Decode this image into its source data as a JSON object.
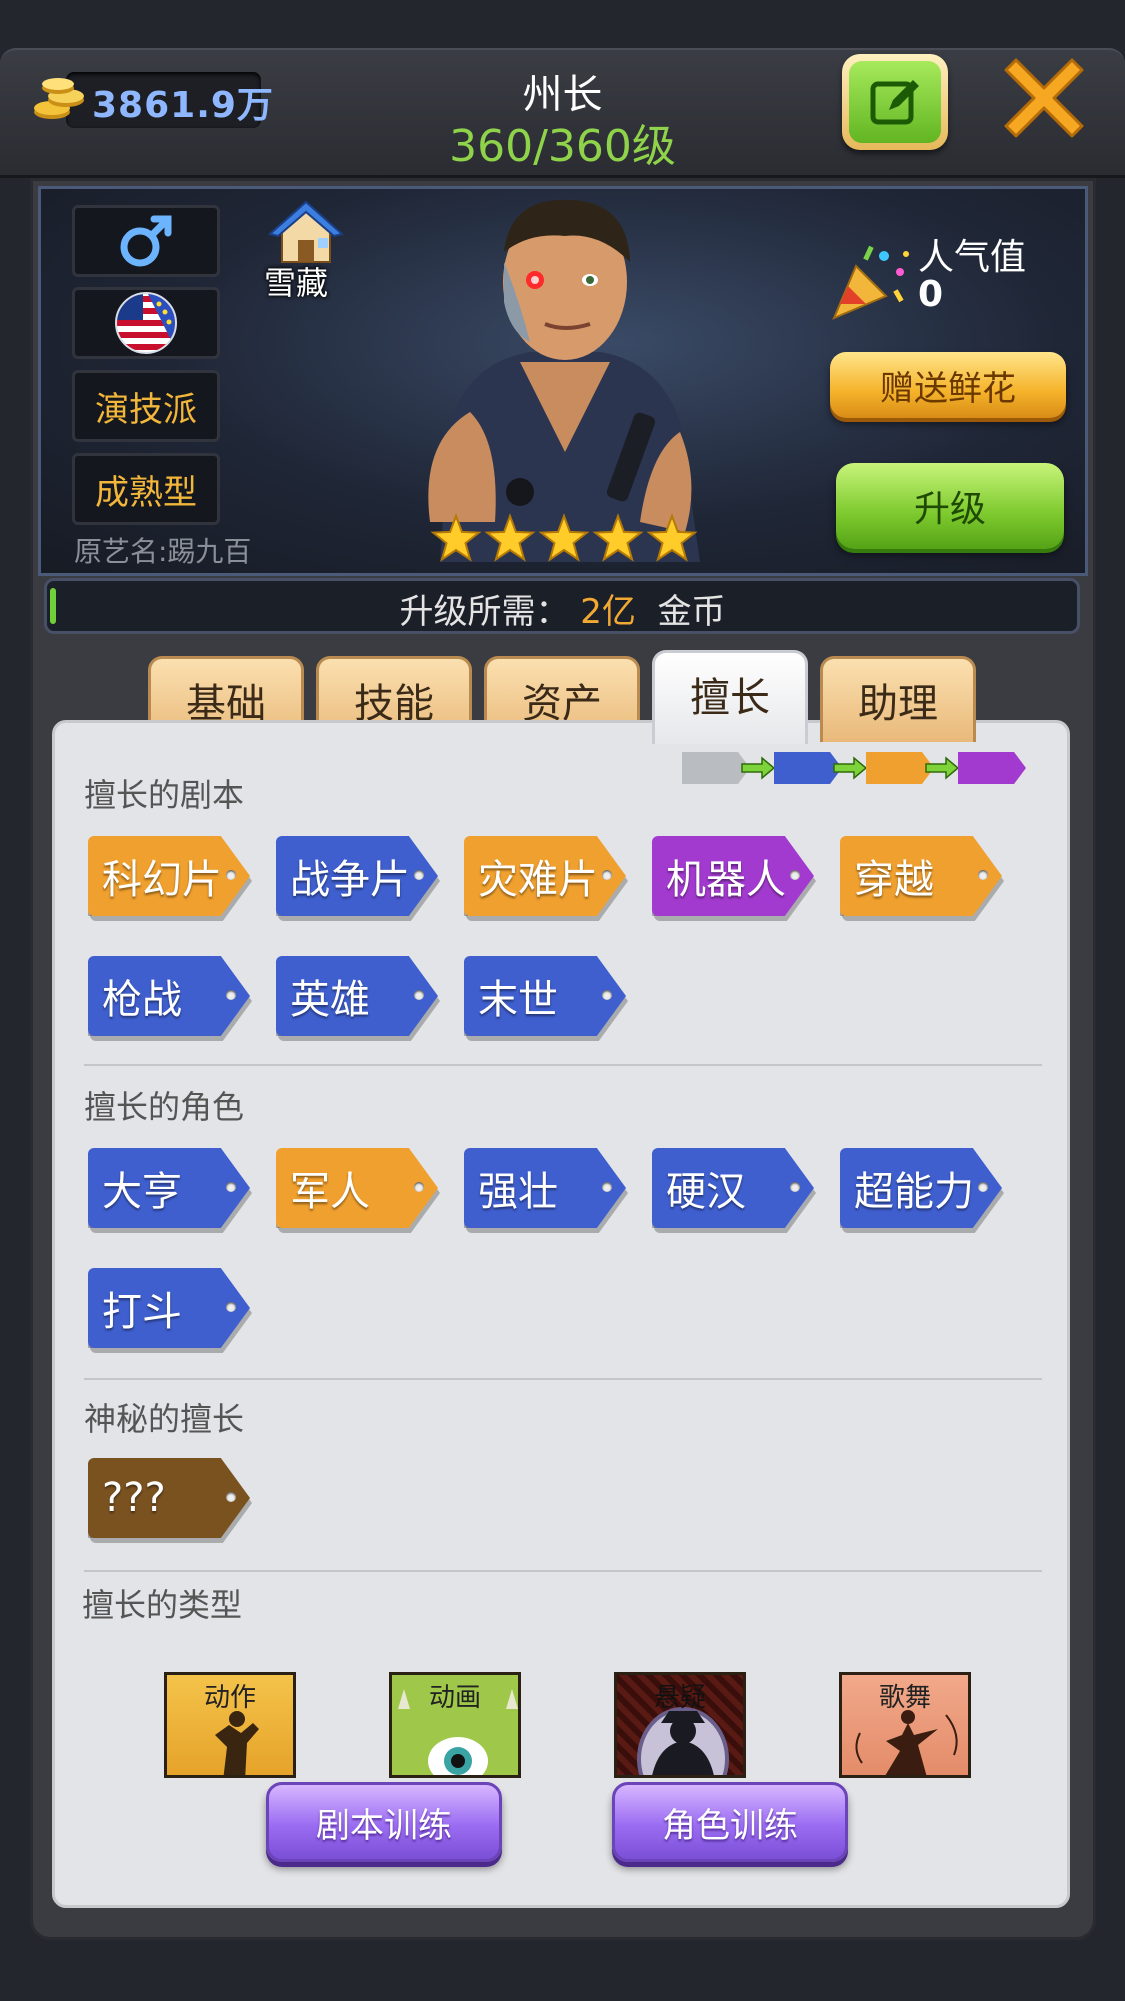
{
  "header": {
    "coins": "3861.9万",
    "rank_title": "州长",
    "level": "360/360级"
  },
  "profile": {
    "gender_icon": "male-symbol-icon",
    "nationality_icon": "us-eu-flag-icon",
    "acting_style": "演技派",
    "look_type": "成熟型",
    "former_name": "原艺名:踢九百",
    "house_label": "雪藏",
    "star_count": 5,
    "popularity_label": "人气值",
    "popularity_value": "0",
    "send_flowers_label": "赠送鲜花",
    "upgrade_label": "升级",
    "upgrade_cost_prefix": "升级所需：",
    "upgrade_cost_amount": "2亿",
    "upgrade_cost_unit": "金币"
  },
  "tabs": [
    {
      "label": "基础",
      "active": false
    },
    {
      "label": "技能",
      "active": false
    },
    {
      "label": "资产",
      "active": false
    },
    {
      "label": "擅长",
      "active": true
    },
    {
      "label": "助理",
      "active": false
    }
  ],
  "rarity_legend_colors": [
    "#b9bcc1",
    "#3f5fcf",
    "#f0a02e",
    "#a33ad0"
  ],
  "sections": {
    "scripts": {
      "title": "擅长的剧本",
      "tags": [
        {
          "label": "科幻片",
          "color": "#f0a02e"
        },
        {
          "label": "战争片",
          "color": "#3f5fcf"
        },
        {
          "label": "灾难片",
          "color": "#f0a02e"
        },
        {
          "label": "机器人",
          "color": "#a33ad0"
        },
        {
          "label": "穿越",
          "color": "#f0a02e"
        },
        {
          "label": "枪战",
          "color": "#3f5fcf"
        },
        {
          "label": "英雄",
          "color": "#3f5fcf"
        },
        {
          "label": "末世",
          "color": "#3f5fcf"
        }
      ]
    },
    "roles": {
      "title": "擅长的角色",
      "tags": [
        {
          "label": "大亨",
          "color": "#3f5fcf"
        },
        {
          "label": "军人",
          "color": "#f0a02e"
        },
        {
          "label": "强壮",
          "color": "#3f5fcf"
        },
        {
          "label": "硬汉",
          "color": "#3f5fcf"
        },
        {
          "label": "超能力",
          "color": "#3f5fcf"
        },
        {
          "label": "打斗",
          "color": "#3f5fcf"
        }
      ]
    },
    "mystery": {
      "title": "神秘的擅长",
      "tags": [
        {
          "label": "???",
          "color": "#7a5220"
        }
      ]
    },
    "genres": {
      "title": "擅长的类型",
      "cards": [
        {
          "label": "动作",
          "icon": "action-silhouette-icon"
        },
        {
          "label": "动画",
          "icon": "one-eyed-monster-icon"
        },
        {
          "label": "悬疑",
          "icon": "detective-silhouette-icon"
        },
        {
          "label": "歌舞",
          "icon": "dancer-silhouette-icon"
        }
      ]
    }
  },
  "footer_buttons": {
    "script_training": "剧本训练",
    "role_training": "角色训练"
  }
}
